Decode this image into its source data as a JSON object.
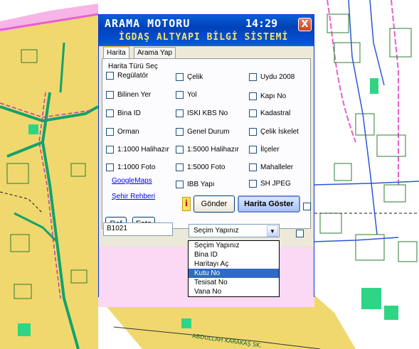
{
  "window": {
    "title": "ARAMA MOTORU",
    "time": "14:29",
    "subtitle": "İGDAŞ ALTYAPI BİLGİ SİSTEMİ",
    "close_label": "X"
  },
  "tabs": [
    {
      "label": "Harita",
      "active": true
    },
    {
      "label": "Arama Yap",
      "active": false
    }
  ],
  "group": {
    "label": "Harita Türü Seç",
    "checkboxes": [
      {
        "label": "Regülatör",
        "checked": false
      },
      {
        "label": "Çelik",
        "checked": false
      },
      {
        "label": "Uydu 2008",
        "checked": false
      },
      {
        "label": "Bilinen Yer",
        "checked": false
      },
      {
        "label": "Yol",
        "checked": false
      },
      {
        "label": "Kapı No",
        "checked": false
      },
      {
        "label": "Bina ID",
        "checked": false
      },
      {
        "label": "ISKI KBS No",
        "checked": false
      },
      {
        "label": "Kadastral",
        "checked": false
      },
      {
        "label": "Orman",
        "checked": false
      },
      {
        "label": "Genel Durum",
        "checked": false
      },
      {
        "label": "Çelik İskelet",
        "checked": false
      },
      {
        "label": "1:1000 Halihazır",
        "checked": false
      },
      {
        "label": "1:5000 Halihazır",
        "checked": false
      },
      {
        "label": "İlçeler",
        "checked": false
      },
      {
        "label": "1:1000 Foto",
        "checked": false
      },
      {
        "label": "1:5000 Foto",
        "checked": false
      },
      {
        "label": "Mahalleler",
        "checked": false
      },
      {
        "label": "IBB Yapı",
        "checked": false
      },
      {
        "label": "SH JPEG",
        "checked": false
      }
    ],
    "links": {
      "google_maps": "GoogleMaps",
      "sehir_rehberi": "Şehir Rehberi"
    }
  },
  "buttons": {
    "ref": "Ref",
    "foto": "Foto",
    "info": "i",
    "gonder": "Gönder",
    "harita_goster": "Harita Göster"
  },
  "search": {
    "value": "B1021"
  },
  "dropdown": {
    "selected": "Seçim Yapınız",
    "options": [
      "Seçim Yapınız",
      "Bina ID",
      "Haritayı Aç",
      "Kutu No",
      "Tesisat No",
      "Vana No"
    ],
    "highlighted": "Kutu No"
  },
  "map": {
    "label": "ABDULLAH KARAKAŞ SK."
  },
  "colors": {
    "title_bar": "#0553d5",
    "subtitle_text": "#f5e26b",
    "map_yellow": "#f0d86e",
    "map_pink": "#fbd8f4",
    "building_green": "#2fd584"
  }
}
